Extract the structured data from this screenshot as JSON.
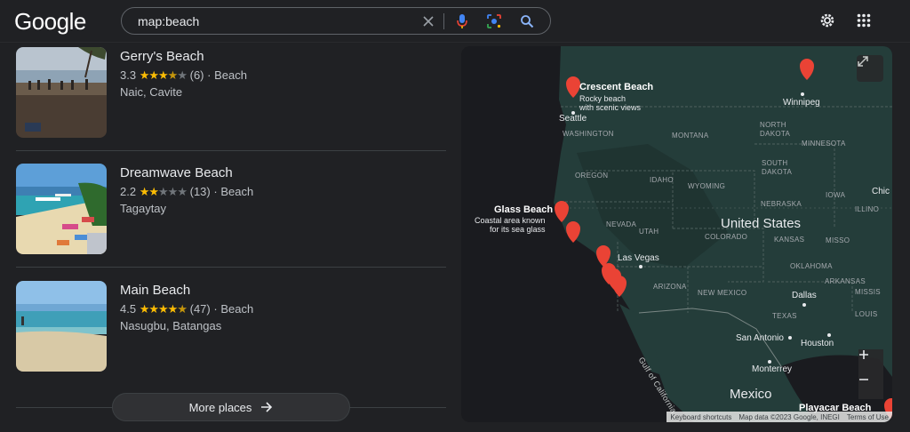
{
  "header": {
    "logo": "Google",
    "query": "map:beach"
  },
  "places": [
    {
      "name": "Gerry's Beach",
      "rating": "3.3",
      "stars_full": 3,
      "stars_half": 1,
      "reviews": "(6)",
      "category": "Beach",
      "location": "Naic, Cavite"
    },
    {
      "name": "Dreamwave Beach",
      "rating": "2.2",
      "stars_full": 2,
      "stars_half": 0,
      "reviews": "(13)",
      "category": "Beach",
      "location": "Tagaytay"
    },
    {
      "name": "Main Beach",
      "rating": "4.5",
      "stars_full": 4,
      "stars_half": 1,
      "reviews": "(47)",
      "category": "Beach",
      "location": "Nasugbu, Batangas"
    }
  ],
  "more_places": "More places",
  "map": {
    "pins": {
      "crescent": {
        "name": "Crescent Beach",
        "desc1": "Rocky beach",
        "desc2": "with scenic views"
      },
      "glass": {
        "name": "Glass Beach",
        "desc1": "Coastal area known",
        "desc2": "for its sea glass"
      },
      "playacar": {
        "name": "Playacar Beach"
      }
    },
    "cities": {
      "seattle": "Seattle",
      "winnipeg": "Winnipeg",
      "las_vegas": "Las Vegas",
      "dallas": "Dallas",
      "san_antonio": "San Antonio",
      "houston": "Houston",
      "monterrey": "Monterrey",
      "chicago": "Chic"
    },
    "states": {
      "washington": "WASHINGTON",
      "montana": "MONTANA",
      "north_dakota_1": "NORTH",
      "north_dakota_2": "DAKOTA",
      "minnesota": "MINNESOTA",
      "south_dakota_1": "SOUTH",
      "south_dakota_2": "DAKOTA",
      "oregon": "OREGON",
      "idaho": "IDAHO",
      "wyoming": "WYOMING",
      "nebraska": "NEBRASKA",
      "iowa": "IOWA",
      "illinois": "ILLINO",
      "nevada": "NEVADA",
      "utah": "UTAH",
      "colorado": "COLORADO",
      "kansas": "KANSAS",
      "missouri": "MISSO",
      "arizona": "ARIZONA",
      "new_mexico": "NEW MEXICO",
      "oklahoma": "OKLAHOMA",
      "arkansas": "ARKANSAS",
      "mississippi": "MISSIS",
      "texas": "TEXAS",
      "louisiana": "LOUIS",
      "gulf": "Gulf of California"
    },
    "countries": {
      "us": "United States",
      "mexico": "Mexico"
    },
    "attribution": {
      "shortcuts": "Keyboard shortcuts",
      "data": "Map data ©2023 Google, INEGI",
      "terms": "Terms of Use"
    }
  }
}
